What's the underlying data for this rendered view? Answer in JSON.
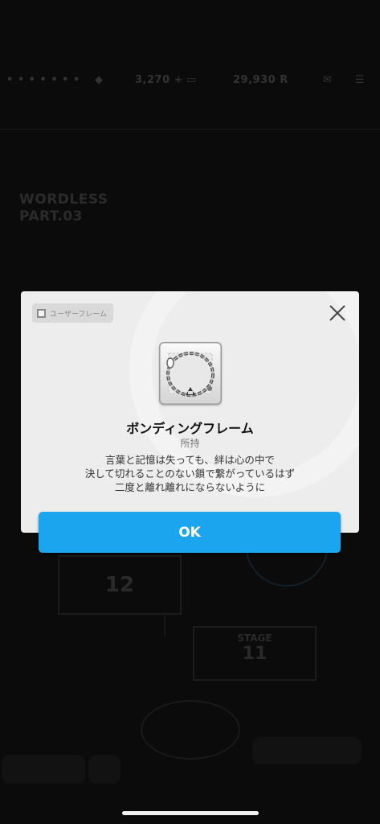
{
  "background": {
    "currency_gems": "3,270 +",
    "currency_coins": "29,930 R",
    "title": "WORDLESS\nPART.03",
    "stage_top": "12",
    "stage_bottom_label": "STAGE",
    "stage_bottom_number": "11"
  },
  "dialog": {
    "tag_label": "ユーザーフレーム",
    "item_name": "ボンディングフレーム",
    "owned_status": "所持",
    "description": "言葉と記憶は失っても、絆は心の中で\n決して切れることのない鎖で繋がっているはず\n二度と離れ離れにならないように",
    "ok_label": "OK"
  },
  "colors": {
    "ok_button": "#1ba5ef",
    "dialog_bg": "#ededed",
    "overlay": "#050505"
  }
}
